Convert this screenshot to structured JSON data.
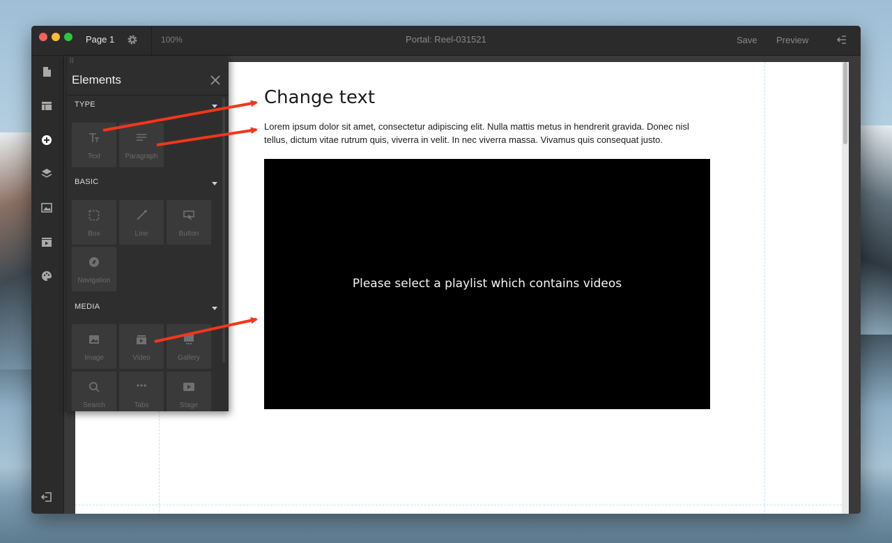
{
  "window": {
    "page_name": "Page 1",
    "zoom": "100%",
    "title": "Portal: Reel-031521",
    "save_label": "Save",
    "preview_label": "Preview"
  },
  "left_toolbar": {
    "icons": [
      "pages-icon",
      "layout-icon",
      "add-element-icon",
      "layers-icon",
      "image-icon",
      "media-icon",
      "theme-palette-icon",
      "exit-icon"
    ]
  },
  "elements_panel": {
    "title": "Elements",
    "sections": [
      {
        "label": "TYPE",
        "items": [
          {
            "label": "Text",
            "icon": "text-icon"
          },
          {
            "label": "Paragraph",
            "icon": "paragraph-icon"
          }
        ]
      },
      {
        "label": "BASIC",
        "items": [
          {
            "label": "Box",
            "icon": "box-icon"
          },
          {
            "label": "Line",
            "icon": "line-icon"
          },
          {
            "label": "Button",
            "icon": "button-icon"
          },
          {
            "label": "Navigation",
            "icon": "navigation-icon"
          }
        ]
      },
      {
        "label": "MEDIA",
        "items": [
          {
            "label": "Image",
            "icon": "image-icon"
          },
          {
            "label": "Video",
            "icon": "video-icon"
          },
          {
            "label": "Gallery",
            "icon": "gallery-icon"
          },
          {
            "label": "Search",
            "icon": "search-icon"
          },
          {
            "label": "Tabs",
            "icon": "tabs-icon"
          },
          {
            "label": "Stage",
            "icon": "stage-icon"
          }
        ]
      }
    ]
  },
  "canvas": {
    "heading": "Change text",
    "paragraph": "Lorem ipsum dolor sit amet, consectetur adipiscing elit. Nulla mattis metus in hendrerit gravida. Donec nisl tellus, dictum vitae rutrum quis, viverra in velit. In nec viverra massa. Vivamus quis consequat justo.",
    "video_message": "Please select a playlist which contains videos"
  },
  "colors": {
    "annotation_arrow": "#f3361b",
    "traffic_red": "#fe5f57",
    "traffic_yellow": "#febc2e",
    "traffic_green": "#28c840"
  }
}
